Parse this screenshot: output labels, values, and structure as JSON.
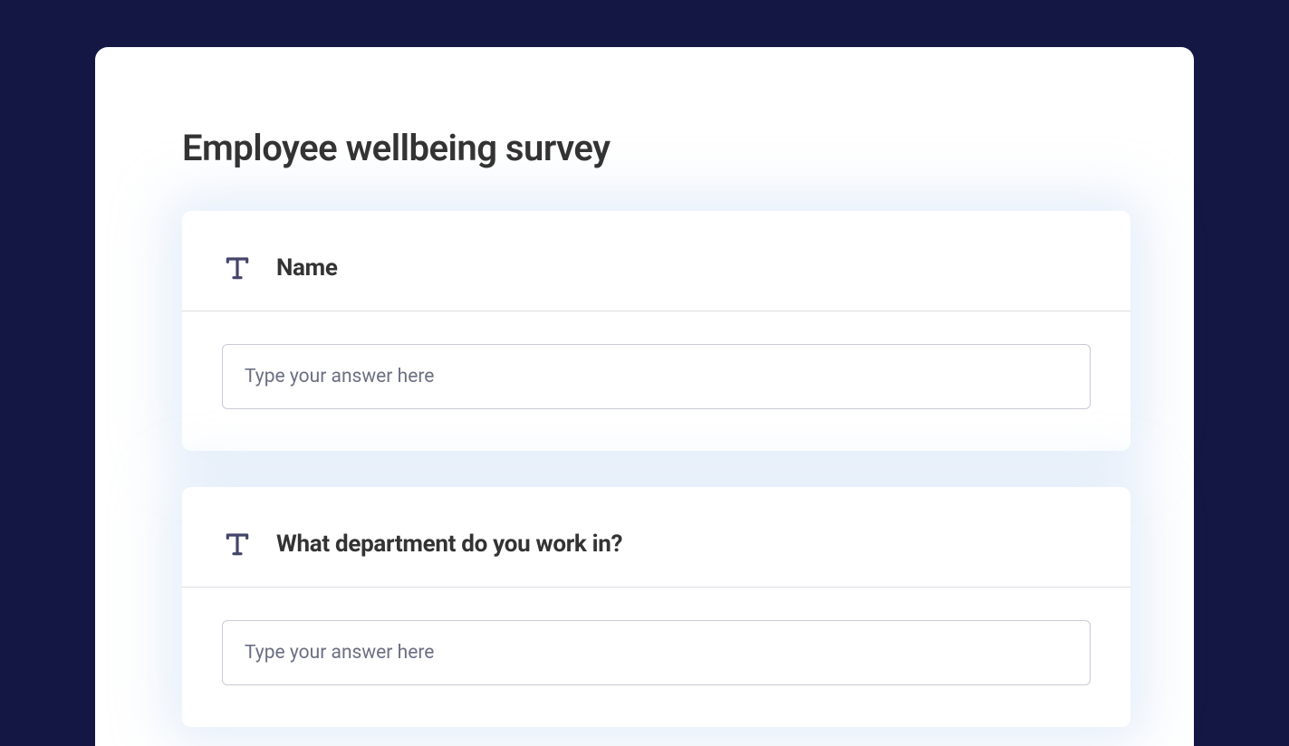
{
  "form": {
    "title": "Employee wellbeing survey",
    "questions": [
      {
        "label": "Name",
        "placeholder": "Type your answer here",
        "value": ""
      },
      {
        "label": "What department do you work in?",
        "placeholder": "Type your answer here",
        "value": ""
      }
    ]
  }
}
